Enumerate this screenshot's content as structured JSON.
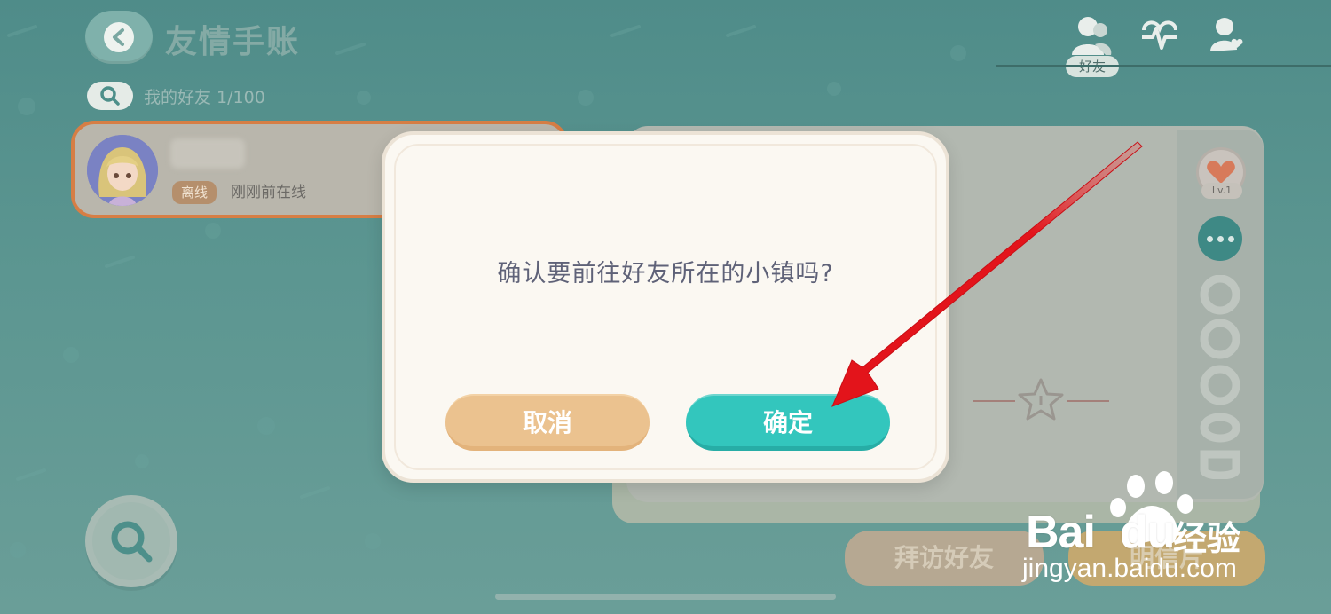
{
  "header": {
    "title": "友情手账",
    "tabs": [
      {
        "icon": "friends-icon",
        "label": "好友",
        "active": true
      },
      {
        "icon": "activity-icon"
      },
      {
        "icon": "heart-user-icon"
      }
    ]
  },
  "friends_list": {
    "label": "我的好友 1/100",
    "items": [
      {
        "status": "离线",
        "last_online": "刚刚前在线"
      }
    ]
  },
  "detail": {
    "level": "Lv.1",
    "visit_button": "拜访好友",
    "postcard_button": "明信片"
  },
  "dialog": {
    "message": "确认要前往好友所在的小镇吗?",
    "cancel_label": "取消",
    "confirm_label": "确定"
  },
  "watermark": {
    "brand": "Bai",
    "brand_suffix": "du",
    "cn": "经验",
    "url": "jingyan.baidu.com"
  },
  "colors": {
    "background": "#5c9691",
    "confirm": "#33c6bd",
    "cancel": "#ebc28f",
    "arrow": "#e3141b",
    "selected_card_border": "#d67e45"
  }
}
